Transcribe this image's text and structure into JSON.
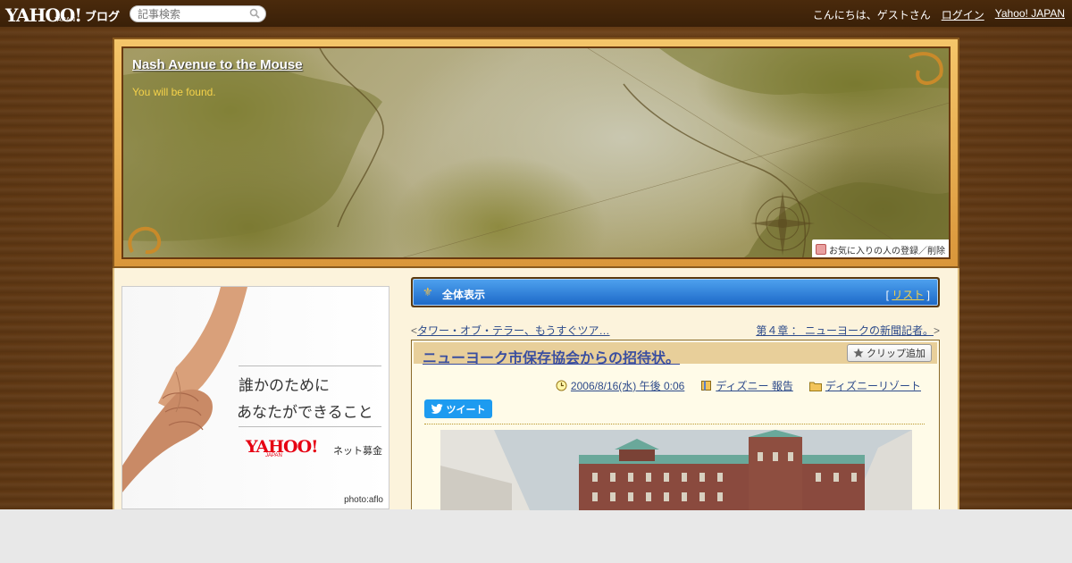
{
  "topbar": {
    "logo_text": "YAHOO!",
    "logo_sub": "JAPAN",
    "logo_blog": "ブログ",
    "search_placeholder": "記事検索",
    "greeting": "こんにちは、ゲストさん",
    "login": "ログイン",
    "yahoo_japan": "Yahoo! JAPAN"
  },
  "header": {
    "blog_title": "Nash Avenue to the Mouse",
    "subtitle": "You will be found.",
    "favorite_label": "お気に入りの人の登録／削除"
  },
  "ad": {
    "line1": "誰かのために",
    "line2": "あなたができること",
    "logo": "YAHOO!",
    "logo_sub": "JAPAN",
    "service": "ネット募金",
    "credit": "photo:aflo"
  },
  "nav": {
    "all_label": "全体表示",
    "list_open": "[ ",
    "list_label": "リスト",
    "list_close": " ]"
  },
  "prevnext": {
    "prev_marker": "<",
    "prev_label": "タワー・オブ・テラー、もうすぐツア…",
    "next_label": "第４章 ： ニューヨークの新聞記者。",
    "next_marker": ">"
  },
  "article": {
    "title": "ニューヨーク市保存協会からの招待状。",
    "clip_label": "クリップ追加",
    "date": "2006/8/16(水) 午後 0:06",
    "category": "ディズニー 報告",
    "folder": "ディズニーリゾート",
    "tweet_label": "ツイート"
  },
  "colors": {
    "topbar": "#3a2008",
    "wood": "#6a3f17",
    "content_bg": "#fcf3dc",
    "nav_blue": "#1e6ac8",
    "link": "#2c4a8a",
    "subtitle": "#f5d24a",
    "tweet": "#1d9bf0"
  }
}
